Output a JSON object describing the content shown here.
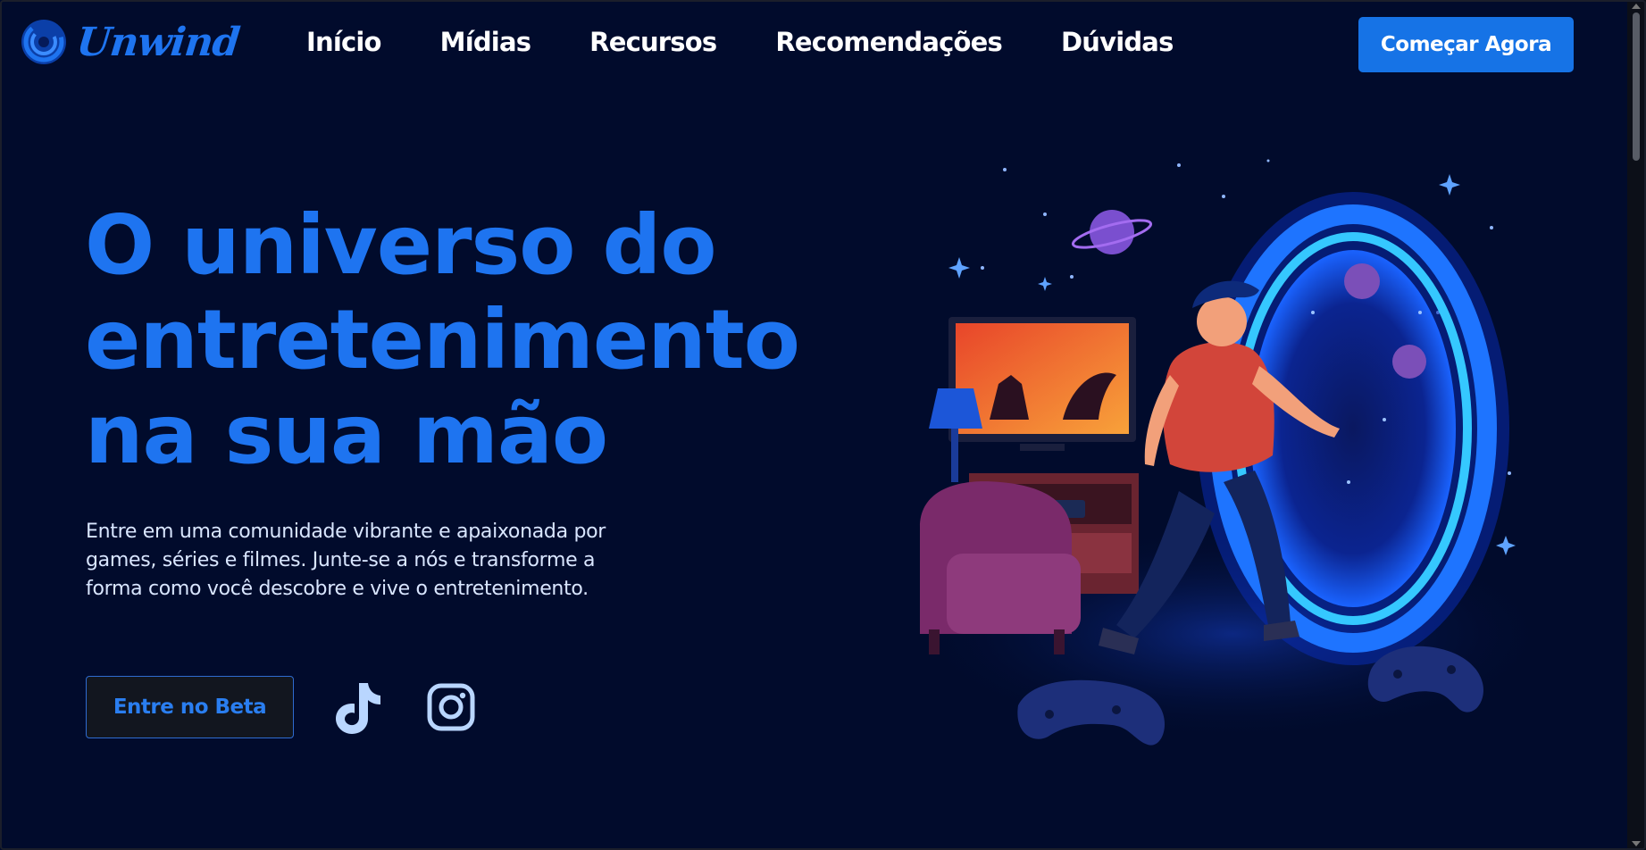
{
  "brand": {
    "name": "Unwind",
    "logo_icon": "swirl-logo-icon",
    "accent_color": "#1e74f0"
  },
  "nav": {
    "items": [
      {
        "label": "Início"
      },
      {
        "label": "Mídias"
      },
      {
        "label": "Recursos"
      },
      {
        "label": "Recomendações"
      },
      {
        "label": "Dúvidas"
      }
    ],
    "cta_label": "Começar Agora"
  },
  "hero": {
    "title_lines": [
      "O universo do",
      "entretenimento",
      "na sua mão"
    ],
    "description": "Entre em uma comunidade vibrante e apaixonada por games, séries e filmes. Junte-se a nós e transforme a forma como você descobre e vive o entretenimento.",
    "beta_button_label": "Entre no Beta",
    "social_icons": [
      "tiktok-icon",
      "instagram-icon"
    ]
  },
  "colors": {
    "background": "#010b2c",
    "button_primary": "#1673e6",
    "text_light": "#d9e6ff"
  }
}
